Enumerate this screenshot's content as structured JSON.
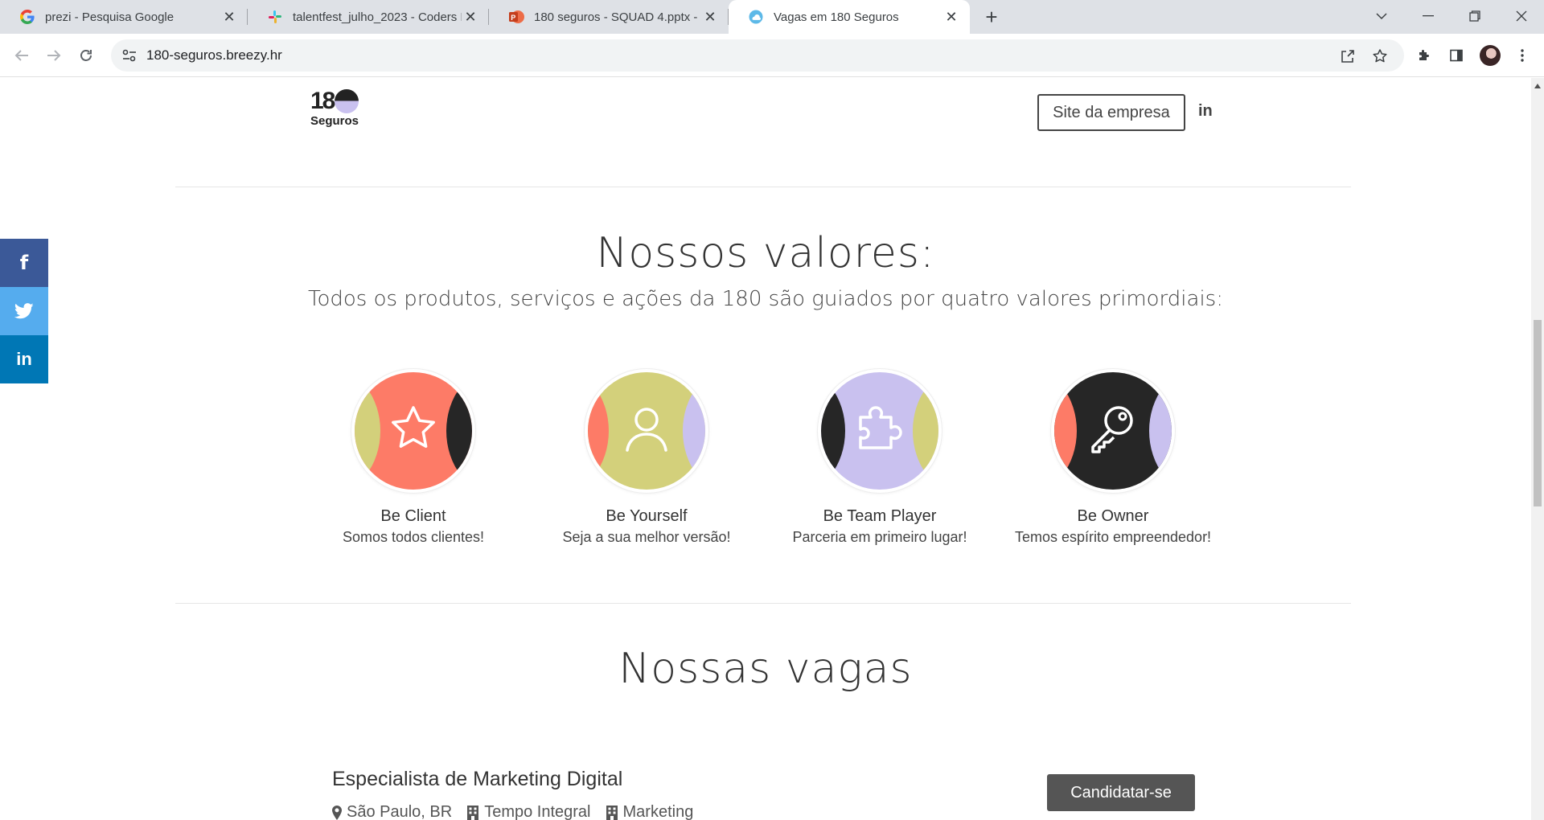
{
  "browser": {
    "tabs": [
      {
        "title": "prezi - Pesquisa Google",
        "icon": "google-icon"
      },
      {
        "title": "talentfest_julho_2023 - Coders La",
        "icon": "slack-icon"
      },
      {
        "title": "180 seguros - SQUAD 4.pptx - M",
        "icon": "powerpoint-icon"
      },
      {
        "title": "Vagas em 180 Seguros",
        "icon": "breezy-icon",
        "active": true
      }
    ],
    "url": "180-seguros.breezy.hr"
  },
  "header": {
    "logo_number": "18",
    "logo_name": "Seguros",
    "site_button": "Site da empresa",
    "linkedin_label": "in"
  },
  "values_section": {
    "title": "Nossos valores:",
    "subtitle": "Todos os produtos, serviços e ações da 180 são guiados por quatro valores primordiais:",
    "items": [
      {
        "name": "Be Client",
        "desc": "Somos todos clientes!",
        "icon": "star-icon"
      },
      {
        "name": "Be Yourself",
        "desc": "Seja a sua melhor versão!",
        "icon": "person-icon"
      },
      {
        "name": "Be Team Player",
        "desc": "Parceria em primeiro lugar!",
        "icon": "puzzle-icon"
      },
      {
        "name": "Be Owner",
        "desc": "Temos espírito empreendedor!",
        "icon": "key-icon"
      }
    ]
  },
  "jobs_section": {
    "title": "Nossas vagas",
    "jobs": [
      {
        "title": "Especialista de Marketing Digital",
        "location": "São Paulo, BR",
        "type": "Tempo Integral",
        "department": "Marketing",
        "apply_label": "Candidatar-se"
      }
    ]
  },
  "social": {
    "facebook_label": "f",
    "linkedin_label": "in"
  },
  "colors": {
    "coral": "#fd7b67",
    "olive": "#d3d07b",
    "lavender": "#c9c1ef",
    "dark": "#262626",
    "facebook": "#3b5998",
    "twitter": "#55acee",
    "linkedin": "#0077b5"
  }
}
